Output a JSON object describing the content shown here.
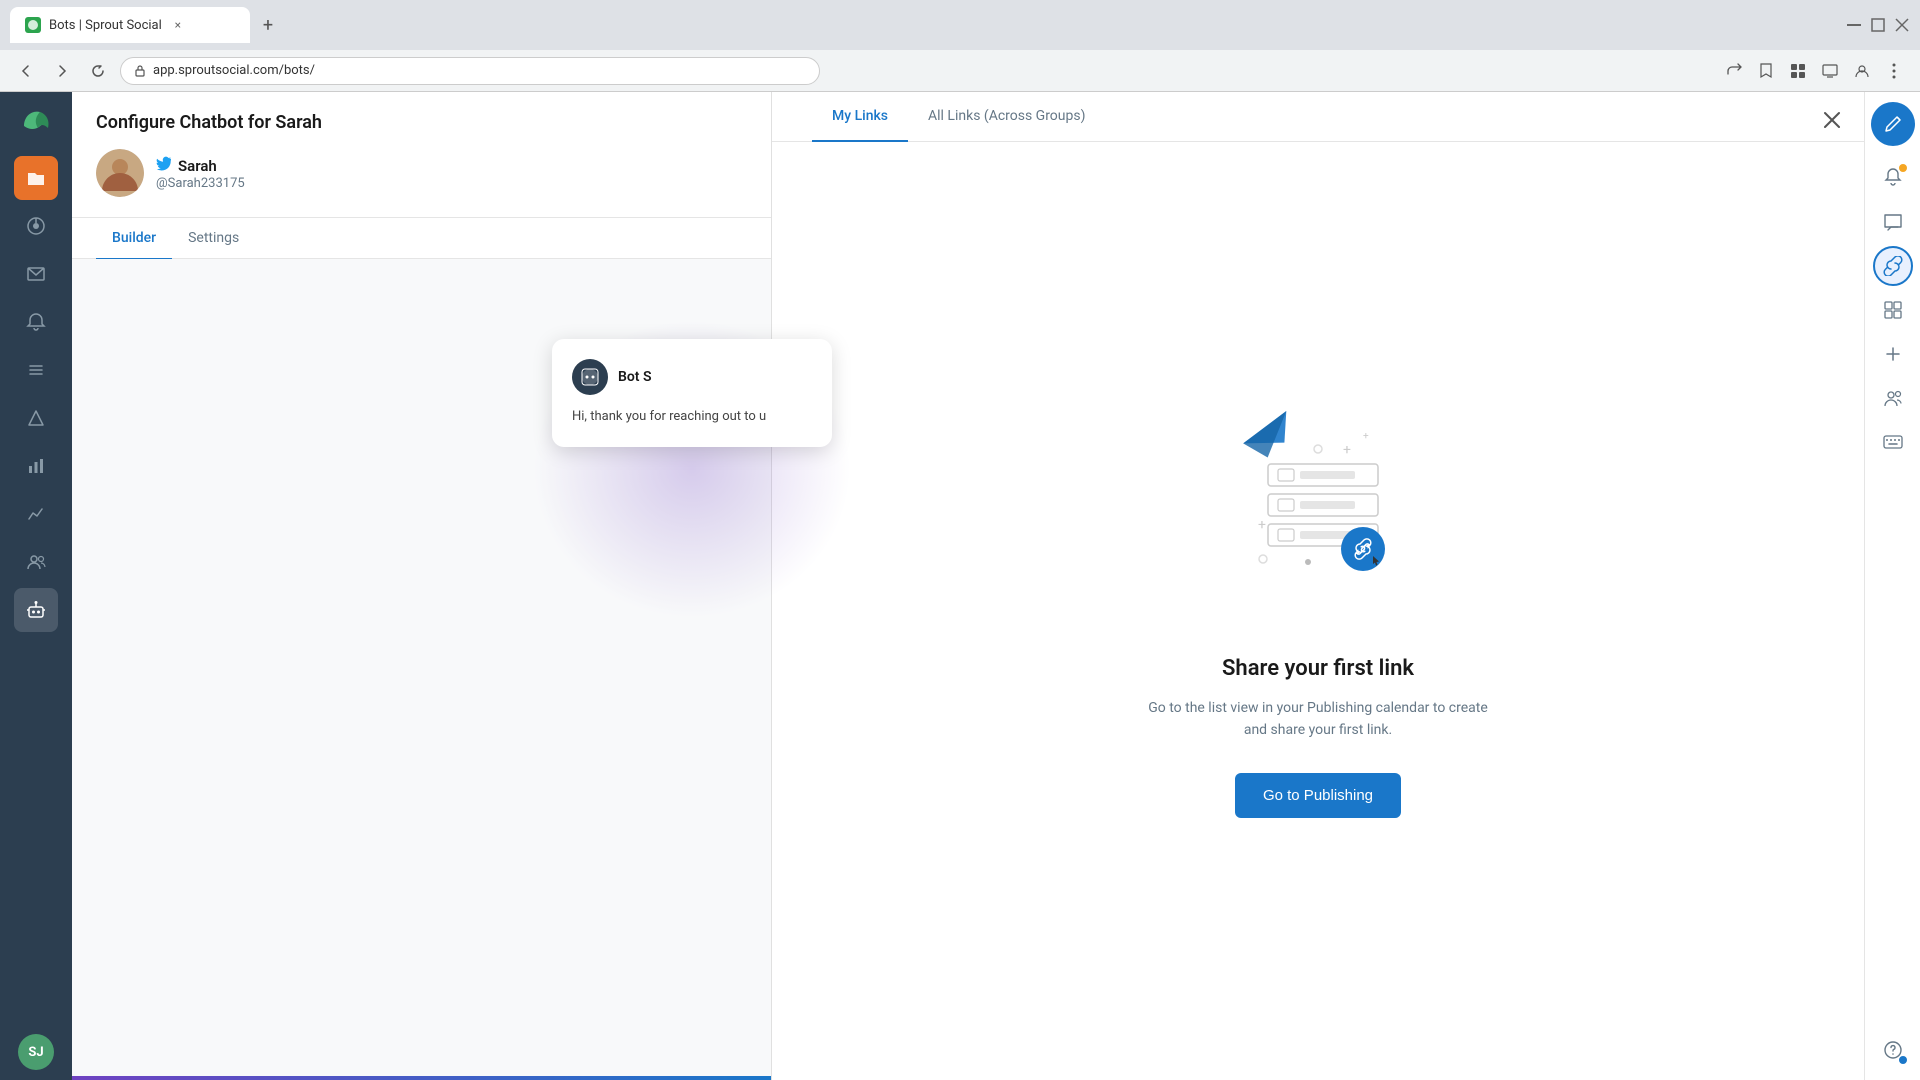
{
  "browser": {
    "tab_title": "Bots | Sprout Social",
    "tab_close_icon": "×",
    "new_tab_icon": "+",
    "url": "app.sproutsocial.com/bots/",
    "nav_back": "‹",
    "nav_forward": "›",
    "nav_refresh": "↻",
    "window_minimize": "–",
    "window_maximize": "⧠",
    "window_close": "×"
  },
  "sidebar": {
    "logo_text": "🌱",
    "items": [
      {
        "id": "orange-folder",
        "icon": "📁",
        "active": false,
        "orange": true
      },
      {
        "id": "dashboard",
        "icon": "⊙",
        "active": false
      },
      {
        "id": "inbox",
        "icon": "✉",
        "active": false
      },
      {
        "id": "notifications",
        "icon": "🔔",
        "active": false
      },
      {
        "id": "tasks",
        "icon": "☰",
        "active": false
      },
      {
        "id": "send",
        "icon": "✈",
        "active": false
      },
      {
        "id": "analytics-bar",
        "icon": "📊",
        "active": false
      },
      {
        "id": "analytics-chart",
        "icon": "📈",
        "active": false
      },
      {
        "id": "people",
        "icon": "👥",
        "active": false
      },
      {
        "id": "bots",
        "icon": "🤖",
        "active": true
      }
    ],
    "avatar_initials": "SJ"
  },
  "chatbot": {
    "header_title": "Configure Chatbot for Sarah",
    "profile_name": "Sarah",
    "profile_handle": "@Sarah233175",
    "tabs": [
      {
        "id": "builder",
        "label": "Builder",
        "active": true
      },
      {
        "id": "settings",
        "label": "Settings",
        "active": false
      }
    ],
    "bot_card": {
      "bot_name": "Bot S",
      "message_text": "Hi, thank you for reaching out to u"
    }
  },
  "link_panel": {
    "tabs": [
      {
        "id": "my-links",
        "label": "My Links",
        "active": true
      },
      {
        "id": "all-links",
        "label": "All Links (Across Groups)",
        "active": false
      }
    ],
    "close_icon": "×",
    "illustration_alt": "Share first link illustration",
    "title": "Share your first link",
    "description": "Go to the list view in your Publishing calendar to create and share your first link.",
    "cta_button": "Go to Publishing"
  },
  "right_bar": {
    "compose_icon": "✏",
    "items": [
      {
        "id": "notifications",
        "icon": "🔔",
        "has_dot": true,
        "dot_color": "orange"
      },
      {
        "id": "messages",
        "icon": "💬",
        "has_dot": false
      },
      {
        "id": "link",
        "icon": "🔗",
        "active": true
      },
      {
        "id": "grid",
        "icon": "⊞",
        "has_dot": false
      },
      {
        "id": "add",
        "icon": "+",
        "has_dot": false
      },
      {
        "id": "people",
        "icon": "👤",
        "has_dot": false
      },
      {
        "id": "keyboard",
        "icon": "⌨",
        "has_dot": false
      },
      {
        "id": "help",
        "icon": "?",
        "has_dot": true,
        "dot_color": "blue"
      }
    ]
  }
}
